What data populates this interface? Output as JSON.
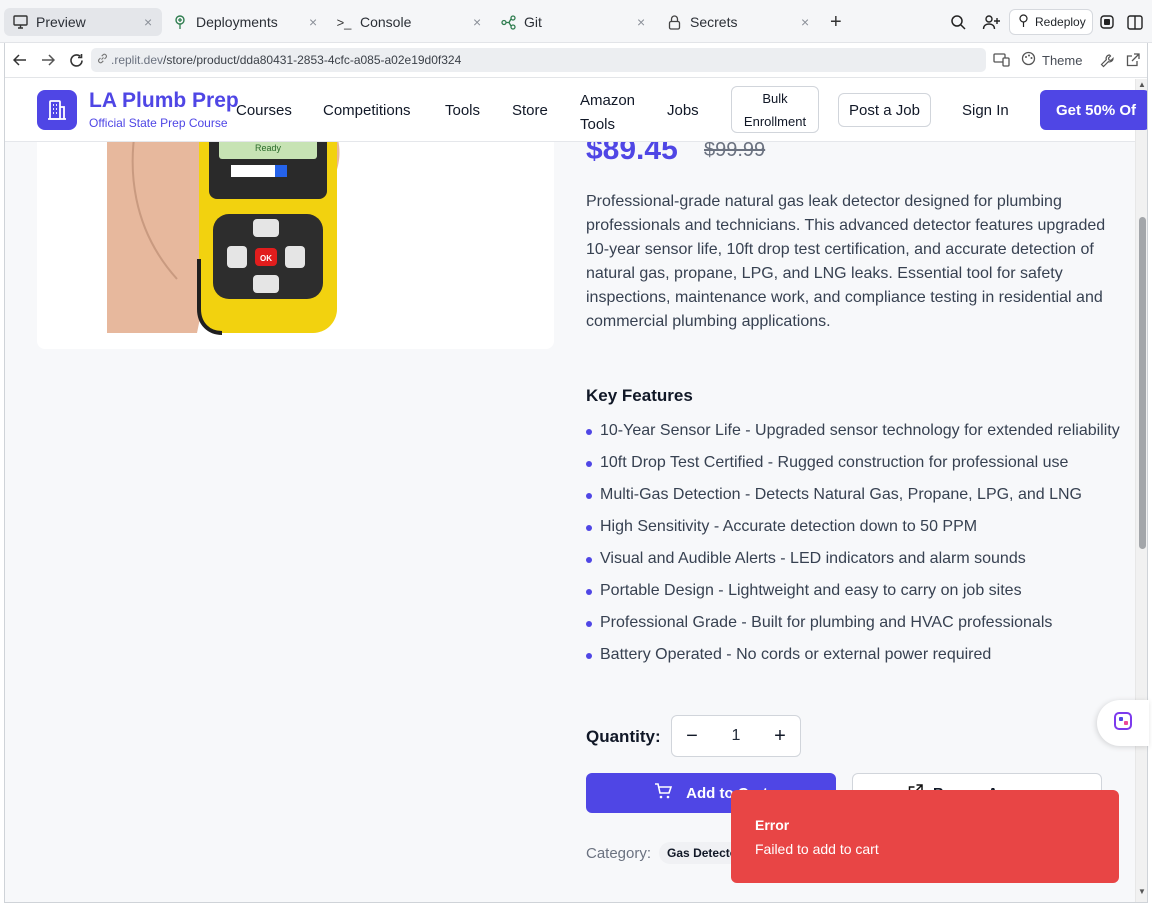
{
  "ide_tabs": [
    {
      "label": "Preview",
      "icon": "monitor-icon"
    },
    {
      "label": "Deployments",
      "icon": "deploy-icon"
    },
    {
      "label": "Console",
      "icon": "terminal-icon"
    },
    {
      "label": "Git",
      "icon": "git-icon"
    },
    {
      "label": "Secrets",
      "icon": "lock-icon"
    }
  ],
  "redeploy_label": "Redeploy",
  "browser": {
    "url_host": ".replit.dev",
    "url_path": "/store/product/dda80431-2853-4cfc-a085-a02e19d0f324",
    "theme_label": "Theme"
  },
  "header": {
    "brand": "LA Plumb Prep",
    "tagline": "Official State Prep Course",
    "nav": {
      "courses": "Courses",
      "competitions": "Competitions",
      "tools": "Tools",
      "store": "Store",
      "amazon_line1": "Amazon",
      "amazon_line2": "Tools",
      "jobs": "Jobs"
    },
    "bulk_line1": "Bulk",
    "bulk_line2": "Enrollment",
    "post_job": "Post a Job",
    "sign_in": "Sign In",
    "cta": "Get 50% Of"
  },
  "product": {
    "price": "$89.45",
    "old_price": "$99.99",
    "description": "Professional-grade natural gas leak detector designed for plumbing professionals and technicians. This advanced detector features upgraded 10-year sensor life, 10ft drop test certification, and accurate detection of natural gas, propane, LPG, and LNG leaks. Essential tool for safety inspections, maintenance work, and compliance testing in residential and commercial plumbing applications.",
    "key_features_title": "Key Features",
    "features": [
      "10-Year Sensor Life - Upgraded sensor technology for extended reliability",
      "10ft Drop Test Certified - Rugged construction for professional use",
      "Multi-Gas Detection - Detects Natural Gas, Propane, LPG, and LNG",
      "High Sensitivity - Accurate detection down to 50 PPM",
      "Visual and Audible Alerts - LED indicators and alarm sounds",
      "Portable Design - Lightweight and easy to carry on job sites",
      "Professional Grade - Built for plumbing and HVAC professionals",
      "Battery Operated - No cords or external power required"
    ],
    "quantity_label": "Quantity:",
    "quantity": "1",
    "qty_minus": "−",
    "qty_plus": "+",
    "add_to_cart": "Add to Cart",
    "buy_amazon": "Buy on Amazon",
    "category_label": "Category:",
    "category": "Gas Detectors",
    "device_screen_text": "Ready",
    "device_ok": "OK"
  },
  "toast": {
    "title": "Error",
    "message": "Failed to add to cart"
  },
  "colors": {
    "brand": "#4f46e5",
    "toast": "#e84545"
  }
}
